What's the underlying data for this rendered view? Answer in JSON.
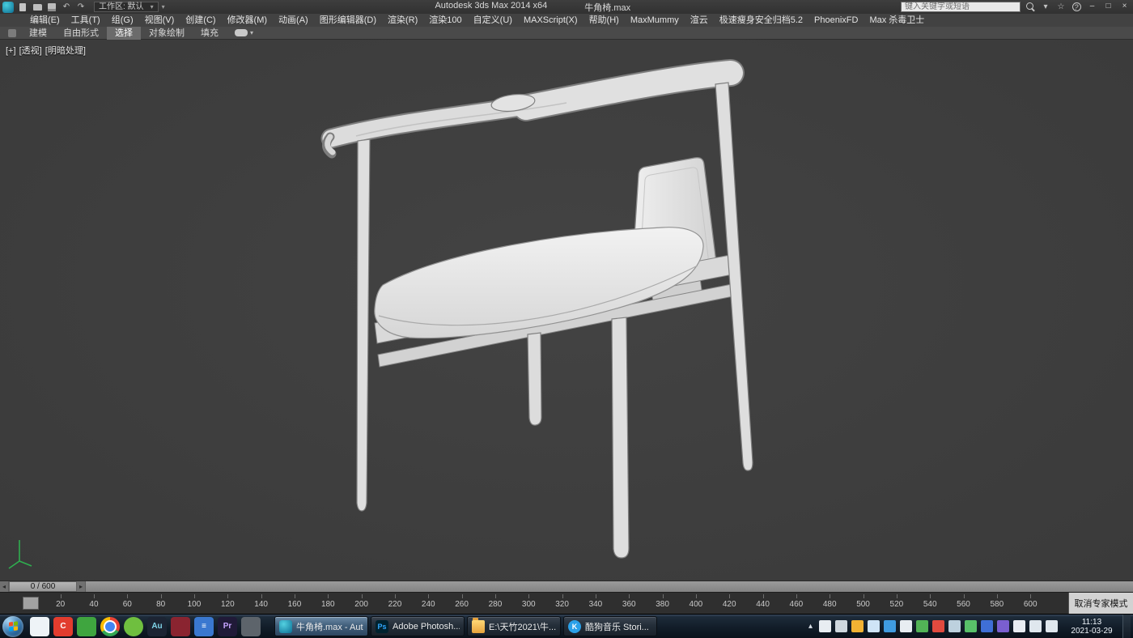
{
  "colors": {
    "viewport_bg": "#3d3d3d",
    "chair_fill": "#e3e3e3",
    "taskbar_bg": "#121d29",
    "active_task": "#42607c"
  },
  "title_bar": {
    "app_title": "Autodesk 3ds Max  2014 x64",
    "file_name": "牛角椅.max",
    "workspace": "工作区: 默认",
    "search_placeholder": "键入关键字或短语",
    "window_buttons": {
      "minimize": "–",
      "maximize": "□",
      "close": "×"
    }
  },
  "menu_bar": {
    "items": [
      "编辑(E)",
      "工具(T)",
      "组(G)",
      "视图(V)",
      "创建(C)",
      "修改器(M)",
      "动画(A)",
      "图形编辑器(D)",
      "渲染(R)",
      "渲染100",
      "自定义(U)",
      "MAXScript(X)",
      "帮助(H)",
      "MaxMummy",
      "渲云",
      "极速瘦身安全归档5.2",
      "PhoenixFD",
      "Max 杀毒卫士"
    ]
  },
  "ribbon": {
    "tabs": [
      {
        "label": "建模",
        "active": false
      },
      {
        "label": "自由形式",
        "active": false
      },
      {
        "label": "选择",
        "active": true
      },
      {
        "label": "对象绘制",
        "active": false
      },
      {
        "label": "填充",
        "active": false
      }
    ]
  },
  "viewport": {
    "label_plus": "[+]",
    "label_view": "[透视]",
    "label_shading": "[明暗处理]"
  },
  "timeline": {
    "frame_indicator": "0 / 600",
    "prev_arrow": "◂",
    "next_arrow": "▸",
    "ticks": [
      20,
      40,
      60,
      80,
      100,
      120,
      140,
      160,
      180,
      200,
      220,
      240,
      260,
      280,
      300,
      320,
      340,
      360,
      380,
      400,
      420,
      440,
      460,
      480,
      500,
      520,
      540,
      560,
      580,
      600
    ]
  },
  "status": {
    "expert_mode_button": "取消专家模式"
  },
  "taskbar": {
    "quick_launch": [
      {
        "name": "messenger-icon",
        "color": "#eef3f7"
      },
      {
        "name": "red-c-app-icon",
        "color": "#e23c2e",
        "label": "C",
        "label_color": "#ffffff"
      },
      {
        "name": "green-cad-app-icon",
        "color": "#3fa53f"
      },
      {
        "name": "chrome-icon",
        "kind": "chrome"
      },
      {
        "name": "green-browser-icon",
        "color": "#6fbf3f",
        "shape": "circle"
      },
      {
        "name": "audition-icon",
        "color": "#1c2433",
        "label": "Au",
        "label_color": "#7fd4e8"
      },
      {
        "name": "dark-red-app-icon",
        "color": "#8a2430"
      },
      {
        "name": "blue-grid-app-icon",
        "color": "#3a78d0",
        "label": "≡",
        "label_color": "#ffffff"
      },
      {
        "name": "premiere-icon",
        "color": "#201a38",
        "label": "Pr",
        "label_color": "#c5a3ff"
      },
      {
        "name": "palette-app-icon",
        "color": "#5d646b"
      }
    ],
    "windows": [
      {
        "name": "max-window-button",
        "icon": "max",
        "label": "牛角椅.max - Aut...",
        "active": true
      },
      {
        "name": "photoshop-window-button",
        "icon": "ps",
        "icon_color": "#00222f",
        "icon_label": "Ps",
        "icon_label_color": "#31a8ff",
        "label": "Adobe Photosh...",
        "active": false
      },
      {
        "name": "explorer-window-button",
        "icon": "folder",
        "label": "E:\\天竹2021\\牛...",
        "active": false
      },
      {
        "name": "kugou-window-button",
        "icon": "kugou",
        "icon_color": "#2aa0e8",
        "icon_label": "K",
        "icon_label_color": "#ffffff",
        "label": "酷狗音乐 Stori...",
        "active": false
      }
    ],
    "tray_icons": [
      {
        "name": "tray-expand-icon",
        "glyph": "▴"
      },
      {
        "name": "ime-tray-icon",
        "color": "#e8edf2"
      },
      {
        "name": "screenshot-tray-icon",
        "color": "#cfd8df"
      },
      {
        "name": "weather-tray-icon",
        "color": "#f2b233"
      },
      {
        "name": "qq-tray-icon",
        "color": "#cfe4f7"
      },
      {
        "name": "netdisk-tray-icon",
        "color": "#3f9be0"
      },
      {
        "name": "wps-tray-icon",
        "color": "#e8edf2"
      },
      {
        "name": "security-tray-icon",
        "color": "#52b356"
      },
      {
        "name": "pdf-tray-icon",
        "color": "#e04a3f"
      },
      {
        "name": "cloud-tray-icon",
        "color": "#bdd1de"
      },
      {
        "name": "wechat-tray-icon",
        "color": "#58c169"
      },
      {
        "name": "music-tray-icon",
        "color": "#3f6fd6"
      },
      {
        "name": "graphics-tray-icon",
        "color": "#7a5fd0"
      },
      {
        "name": "driver-tray-icon",
        "color": "#e8edf2"
      },
      {
        "name": "volume-tray-icon",
        "color": "#dfe7ee"
      },
      {
        "name": "network-tray-icon",
        "color": "#dfe7ee"
      }
    ],
    "clock": {
      "time": "11:13",
      "date": "2021-03-29"
    }
  }
}
